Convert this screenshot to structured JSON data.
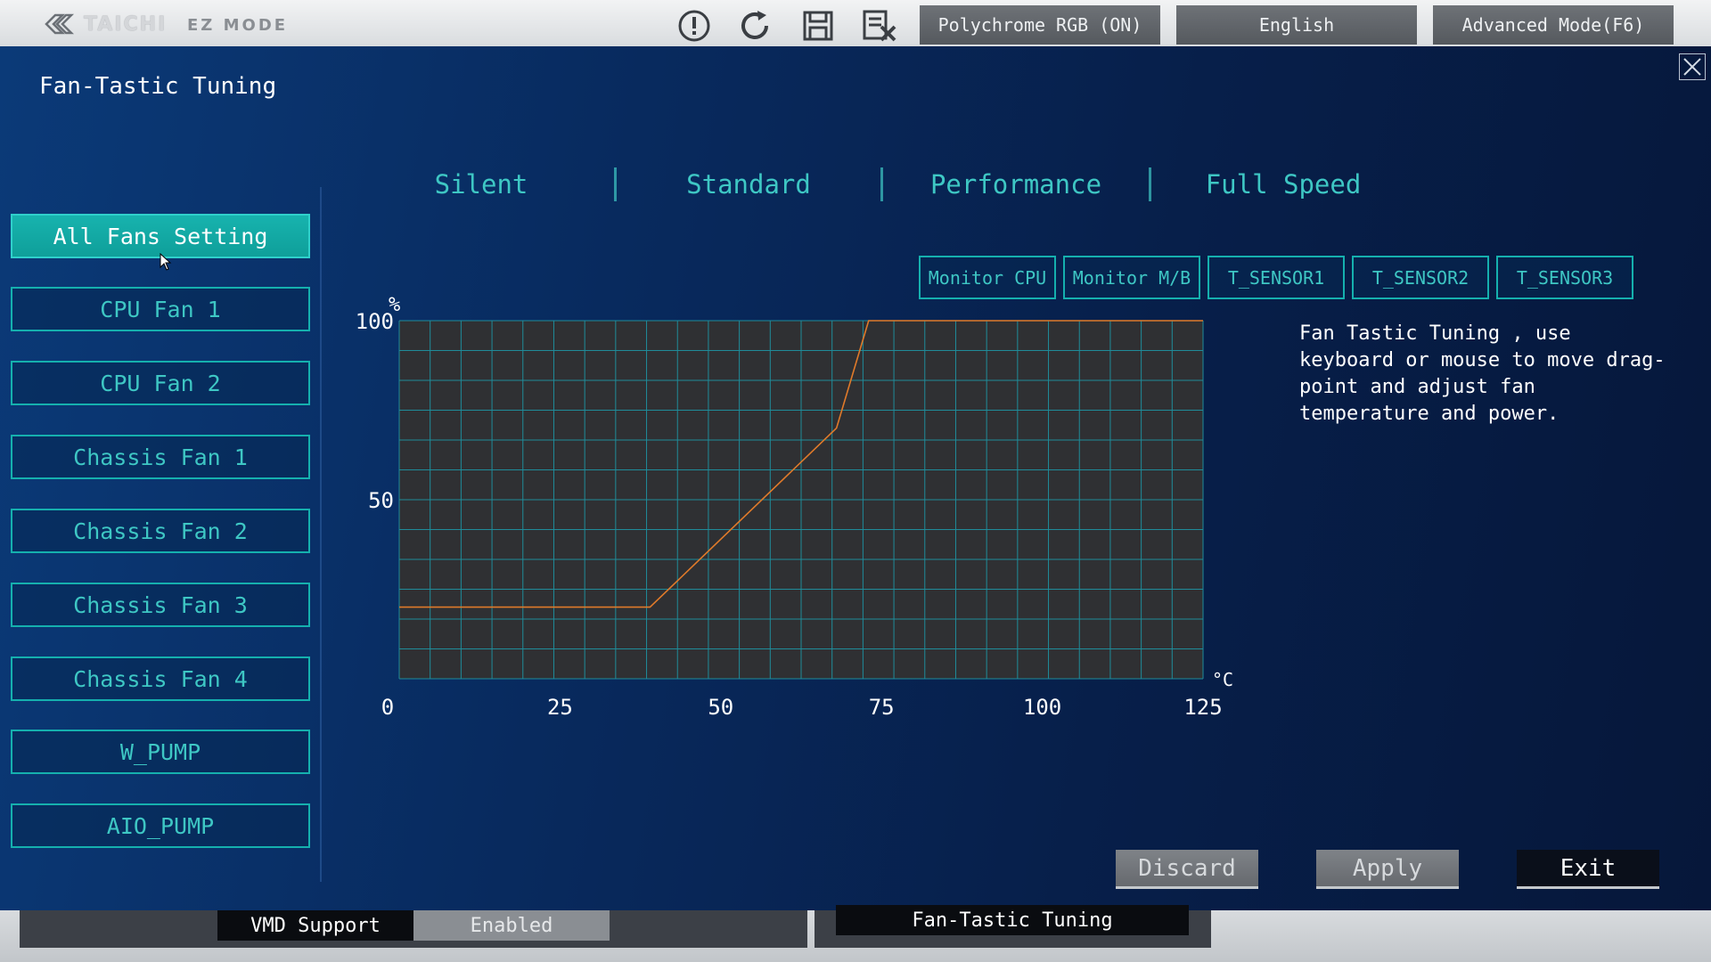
{
  "topbar": {
    "brand_name": "TAICHI",
    "mode": "EZ MODE",
    "tools": [
      {
        "icon": "warning-icon"
      },
      {
        "icon": "refresh-icon"
      },
      {
        "icon": "save-icon"
      },
      {
        "icon": "exit-edit-icon"
      }
    ],
    "polychrome_label": "Polychrome RGB (ON)",
    "language_label": "English",
    "advanced_label": "Advanced Mode(F6)"
  },
  "dialog": {
    "title": "Fan-Tastic Tuning",
    "close_icon": "close-icon"
  },
  "sidebar": {
    "items": [
      {
        "label": "All Fans Setting",
        "active": true
      },
      {
        "label": "CPU Fan 1",
        "active": false
      },
      {
        "label": "CPU Fan 2",
        "active": false
      },
      {
        "label": "Chassis Fan 1",
        "active": false
      },
      {
        "label": "Chassis Fan 2",
        "active": false
      },
      {
        "label": "Chassis Fan 3",
        "active": false
      },
      {
        "label": "Chassis Fan 4",
        "active": false
      },
      {
        "label": "W_PUMP",
        "active": false
      },
      {
        "label": "AIO_PUMP",
        "active": false
      }
    ]
  },
  "presets": [
    "Silent",
    "Standard",
    "Performance",
    "Full Speed"
  ],
  "monitors": [
    "Monitor CPU",
    "Monitor M/B",
    "T_SENSOR1",
    "T_SENSOR2",
    "T_SENSOR3"
  ],
  "chart_data": {
    "type": "line",
    "ylabel": "%",
    "xlabel": "°C",
    "x_ticks": [
      "0",
      "25",
      "50",
      "75",
      "100",
      "125"
    ],
    "y_ticks": [
      "100",
      "50"
    ],
    "xlim": [
      0,
      125
    ],
    "ylim": [
      0,
      100
    ],
    "grid": true,
    "series": [
      {
        "color": "#e07a2a",
        "x": [
          0,
          39,
          68,
          73,
          125
        ],
        "y": [
          20,
          20,
          70,
          100,
          100
        ]
      }
    ]
  },
  "help_text": "Fan Tastic Tuning , use keyboard or mouse to move drag-point and adjust fan temperature and power.",
  "actions": {
    "discard": "Discard",
    "apply": "Apply",
    "exit": "Exit"
  },
  "background": {
    "vmd_label": "VMD Support",
    "vmd_value": "Enabled",
    "fan_tuning_label": "Fan-Tastic Tuning"
  },
  "colors": {
    "accent": "#15b0ae",
    "curve": "#e07a2a",
    "dialog_bg": "#082a5e"
  }
}
